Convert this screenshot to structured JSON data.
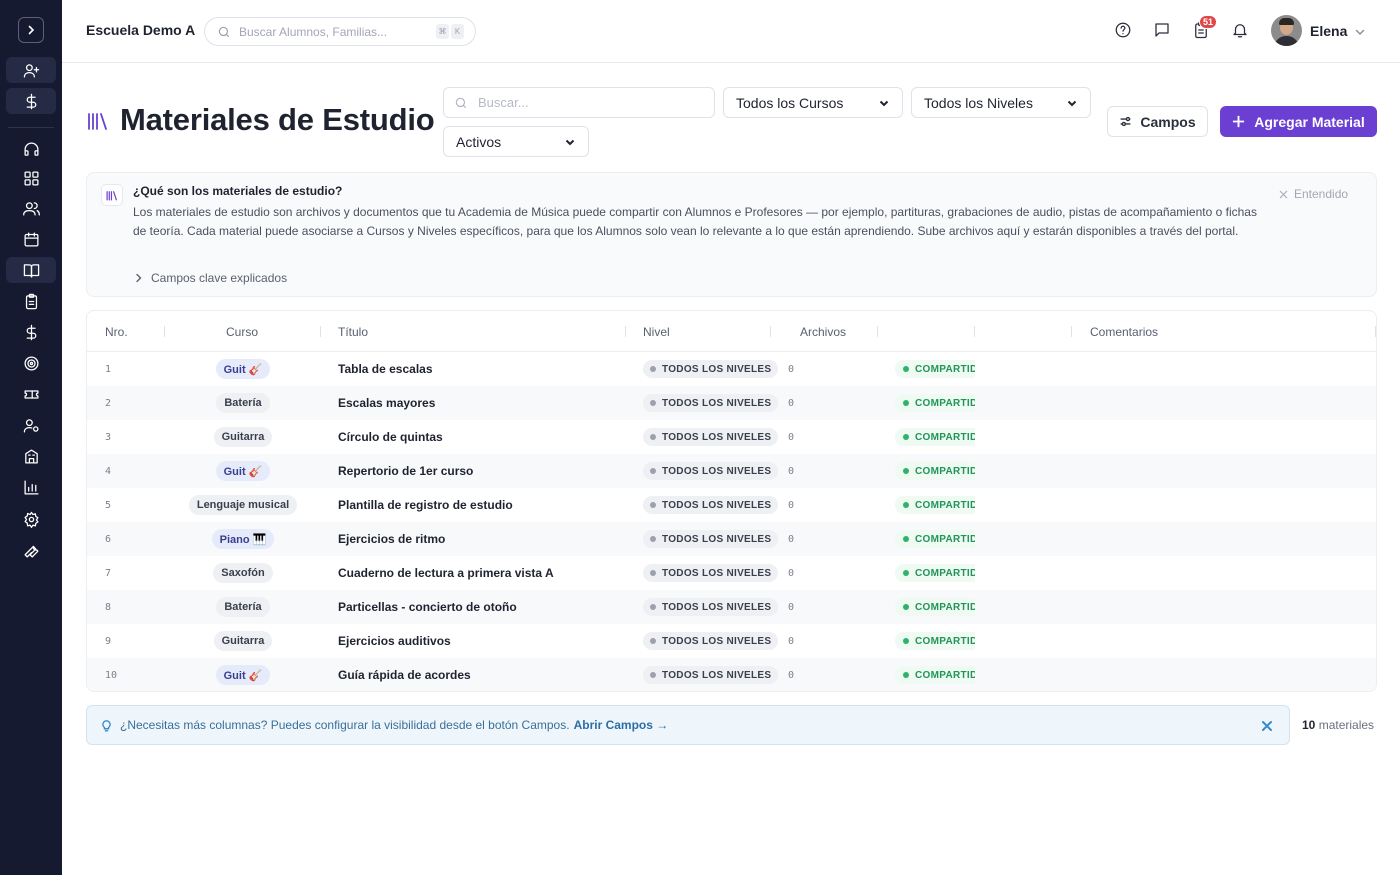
{
  "app": {
    "school_name": "Escuela Demo A",
    "global_search_placeholder": "Buscar Alumnos, Familias...",
    "kbd_keys": [
      "⌘",
      "K"
    ],
    "notification_count": "51",
    "user_name": "Elena"
  },
  "sidebar": {
    "items": [
      {
        "icon": "user-plus-icon"
      },
      {
        "icon": "dollar-icon"
      },
      {
        "icon": "headset-icon"
      },
      {
        "icon": "dashboard-icon"
      },
      {
        "icon": "users-icon"
      },
      {
        "icon": "calendar-icon"
      },
      {
        "icon": "book-icon"
      },
      {
        "icon": "clipboard-icon"
      },
      {
        "icon": "dollar-icon"
      },
      {
        "icon": "target-icon"
      },
      {
        "icon": "ticket-icon"
      },
      {
        "icon": "user-gear-icon"
      },
      {
        "icon": "building-icon"
      },
      {
        "icon": "chart-icon"
      },
      {
        "icon": "settings-icon"
      },
      {
        "icon": "wrench-icon"
      }
    ]
  },
  "page": {
    "title": "Materiales de Estudio",
    "search_placeholder": "Buscar...",
    "filter_courses": "Todos los Cursos",
    "filter_levels": "Todos los Niveles",
    "filter_status": "Activos",
    "fields_button": "Campos",
    "add_button": "Agregar Material"
  },
  "info": {
    "title": "¿Qué son los materiales de estudio?",
    "text": "Los materiales de estudio son archivos y documentos que tu Academia de Música puede compartir con Alumnos e Profesores — por ejemplo, partituras, grabaciones de audio, pistas de acompañamiento o fichas de teoría. Cada material puede asociarse a Cursos y Niveles específicos, para que los Alumnos solo vean lo relevante a lo que están aprendiendo. Sube archivos aquí y estarán disponibles a través del portal.",
    "dismiss": "Entendido",
    "expand": "Campos clave explicados"
  },
  "table": {
    "headers": {
      "num": "Nro.",
      "course": "Curso",
      "title": "Título",
      "level": "Nivel",
      "files": "Archivos",
      "comments": "Comentarios"
    },
    "rows": [
      {
        "num": "1",
        "course": "Guit 🎸",
        "course_color": "#e6ebfb",
        "title": "Tabla de escalas",
        "level": "TODOS LOS NIVELES",
        "files": "0",
        "status": "COMPARTID"
      },
      {
        "num": "2",
        "course": "Batería",
        "course_color": "#eef0f3",
        "title": "Escalas mayores",
        "level": "TODOS LOS NIVELES",
        "files": "0",
        "status": "COMPARTID"
      },
      {
        "num": "3",
        "course": "Guitarra",
        "course_color": "#eef0f3",
        "title": "Círculo de quintas",
        "level": "TODOS LOS NIVELES",
        "files": "0",
        "status": "COMPARTID"
      },
      {
        "num": "4",
        "course": "Guit 🎸",
        "course_color": "#e6ebfb",
        "title": "Repertorio de 1er curso",
        "level": "TODOS LOS NIVELES",
        "files": "0",
        "status": "COMPARTID"
      },
      {
        "num": "5",
        "course": "Lenguaje musical",
        "course_color": "#eef0f3",
        "title": "Plantilla de registro de estudio",
        "level": "TODOS LOS NIVELES",
        "files": "0",
        "status": "COMPARTID"
      },
      {
        "num": "6",
        "course": "Piano 🎹",
        "course_color": "#e6ebfb",
        "title": "Ejercicios de ritmo",
        "level": "TODOS LOS NIVELES",
        "files": "0",
        "status": "COMPARTID"
      },
      {
        "num": "7",
        "course": "Saxofón",
        "course_color": "#eef0f3",
        "title": "Cuaderno de lectura a primera vista A",
        "level": "TODOS LOS NIVELES",
        "files": "0",
        "status": "COMPARTID"
      },
      {
        "num": "8",
        "course": "Batería",
        "course_color": "#eef0f3",
        "title": "Particellas - concierto de otoño",
        "level": "TODOS LOS NIVELES",
        "files": "0",
        "status": "COMPARTID"
      },
      {
        "num": "9",
        "course": "Guitarra",
        "course_color": "#eef0f3",
        "title": "Ejercicios auditivos",
        "level": "TODOS LOS NIVELES",
        "files": "0",
        "status": "COMPARTID"
      },
      {
        "num": "10",
        "course": "Guit 🎸",
        "course_color": "#e6ebfb",
        "title": "Guía rápida de acordes",
        "level": "TODOS LOS NIVELES",
        "files": "0",
        "status": "COMPARTID"
      }
    ]
  },
  "hint": {
    "text": "¿Necesitas más columnas? Puedes configurar la visibilidad desde el botón Campos.",
    "link": "Abrir Campos →"
  },
  "footer": {
    "count": "10",
    "count_label": "materiales"
  },
  "colors": {
    "sidebar_bg": "#161a30",
    "accent": "#6b3fd1",
    "shared_green": "#21945a",
    "badge_red": "#e0474a"
  }
}
